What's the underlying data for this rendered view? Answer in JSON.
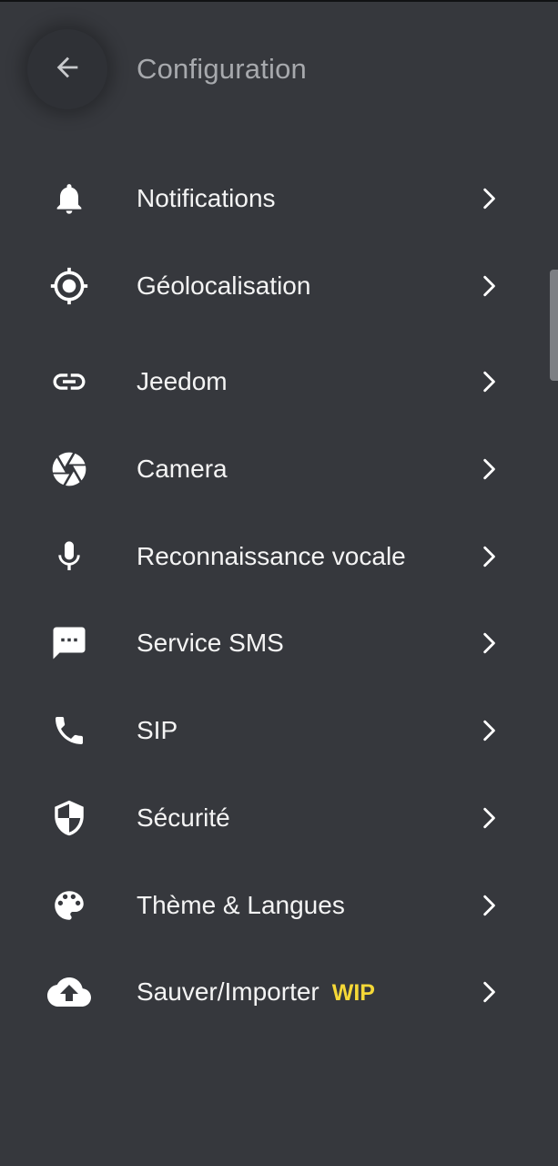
{
  "header": {
    "title": "Configuration",
    "back_icon": "arrow-left-icon"
  },
  "menu": [
    {
      "label": "Notifications",
      "icon": "bell-icon"
    },
    {
      "label": "Géolocalisation",
      "icon": "crosshair-icon"
    },
    {
      "label": "Jeedom",
      "icon": "link-icon"
    },
    {
      "label": "Camera",
      "icon": "camera-aperture-icon"
    },
    {
      "label": "Reconnaissance vocale",
      "icon": "microphone-icon"
    },
    {
      "label": "Service SMS",
      "icon": "sms-icon"
    },
    {
      "label": "SIP",
      "icon": "phone-icon"
    },
    {
      "label": "Sécurité",
      "icon": "shield-icon"
    },
    {
      "label": "Thème & Langues",
      "icon": "palette-icon"
    },
    {
      "label": "Sauver/Importer",
      "badge": "WIP",
      "icon": "cloud-upload-icon"
    }
  ],
  "colors": {
    "background": "#36383d",
    "badge": "#f5d837",
    "text": "#f4f4f4",
    "title": "#a7a9ad"
  }
}
